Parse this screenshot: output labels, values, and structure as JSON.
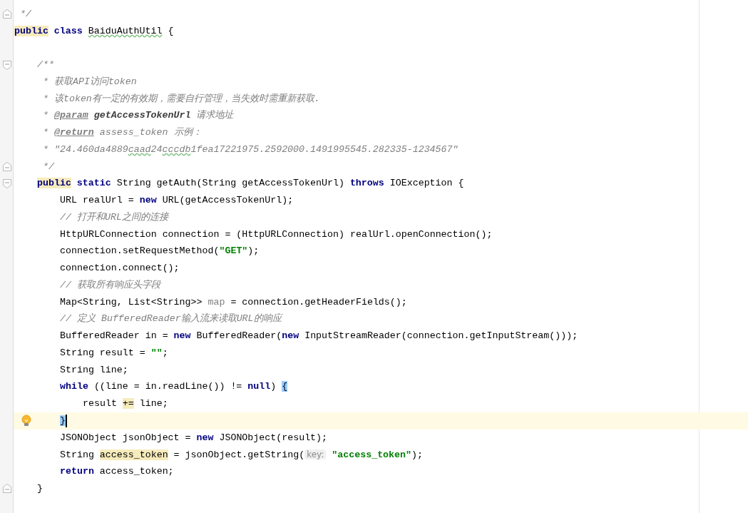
{
  "editor": {
    "lines": [
      {
        "fold_end": true,
        "tokens": [
          {
            "text": " */",
            "kind": "comment"
          }
        ]
      },
      {
        "tokens": [
          {
            "text": "public",
            "kind": "keyword",
            "usage_highlight": true
          },
          {
            "text": " class ",
            "kind": "keyword"
          },
          {
            "text": "BaiduAuthUtil",
            "typo": true
          },
          {
            "text": " {"
          }
        ],
        "children": [
          {
            "blank": true
          },
          {
            "fold_start": true,
            "tokens": [
              {
                "text": "/**",
                "kind": "comment"
              }
            ]
          },
          {
            "tokens": [
              {
                "text": " * 获取API访问token",
                "kind": "comment"
              }
            ]
          },
          {
            "tokens": [
              {
                "text": " * 该token有一定的有效期，需要自行管理，当失效时需重新获取.",
                "kind": "comment"
              }
            ]
          },
          {
            "tokens": [
              {
                "text": " * ",
                "kind": "comment"
              },
              {
                "text": "@param",
                "kind": "doc-tag"
              },
              {
                "text": " getAccessTokenUrl",
                "kind": "doc-param"
              },
              {
                "text": " 请求地址",
                "kind": "comment"
              }
            ]
          },
          {
            "tokens": [
              {
                "text": " * ",
                "kind": "comment"
              },
              {
                "text": "@return",
                "kind": "doc-tag"
              },
              {
                "text": " assess_token 示例：",
                "kind": "comment"
              }
            ]
          },
          {
            "tokens": [
              {
                "text": " * \"24.460da4889",
                "kind": "comment"
              },
              {
                "text": "caad",
                "kind": "comment",
                "typo": true
              },
              {
                "text": "24",
                "kind": "comment"
              },
              {
                "text": "cccdb",
                "kind": "comment",
                "typo": true
              },
              {
                "text": "1fea17221975.2592000.1491995545.282335-1234567\"",
                "kind": "comment"
              }
            ]
          },
          {
            "fold_end": true,
            "tokens": [
              {
                "text": " */",
                "kind": "comment"
              }
            ]
          },
          {
            "fold_start": true,
            "tokens": [
              {
                "text": "public",
                "kind": "keyword",
                "usage_highlight": true
              },
              {
                "text": " static",
                "kind": "keyword"
              },
              {
                "text": " String getAuth(String getAccessTokenUrl) "
              },
              {
                "text": "throws",
                "kind": "keyword"
              },
              {
                "text": " IOException {"
              }
            ],
            "children": [
              {
                "tokens": [
                  {
                    "text": "URL realUrl = "
                  },
                  {
                    "text": "new",
                    "kind": "keyword"
                  },
                  {
                    "text": " URL(getAccessTokenUrl);"
                  }
                ]
              },
              {
                "tokens": [
                  {
                    "text": "// 打开和URL之间的连接",
                    "kind": "comment"
                  }
                ]
              },
              {
                "tokens": [
                  {
                    "text": "HttpURLConnection connection = (HttpURLConnection) realUrl.openConnection();"
                  }
                ]
              },
              {
                "tokens": [
                  {
                    "text": "connection.setRequestMethod("
                  },
                  {
                    "text": "\"GET\"",
                    "kind": "string"
                  },
                  {
                    "text": ");"
                  }
                ]
              },
              {
                "tokens": [
                  {
                    "text": "connection.connect();"
                  }
                ]
              },
              {
                "tokens": [
                  {
                    "text": "// 获取所有响应头字段",
                    "kind": "comment"
                  }
                ]
              },
              {
                "tokens": [
                  {
                    "text": "Map<String, List<String>> "
                  },
                  {
                    "text": "map",
                    "kind": "unused"
                  },
                  {
                    "text": " = connection.getHeaderFields();"
                  }
                ]
              },
              {
                "tokens": [
                  {
                    "text": "// 定义 BufferedReader输入流来读取URL的响应",
                    "kind": "comment"
                  }
                ]
              },
              {
                "tokens": [
                  {
                    "text": "BufferedReader in = "
                  },
                  {
                    "text": "new",
                    "kind": "keyword"
                  },
                  {
                    "text": " BufferedReader("
                  },
                  {
                    "text": "new",
                    "kind": "keyword"
                  },
                  {
                    "text": " InputStreamReader(connection.getInputStream()));"
                  }
                ]
              },
              {
                "tokens": [
                  {
                    "text": "String result = "
                  },
                  {
                    "text": "\"\"",
                    "kind": "string"
                  },
                  {
                    "text": ";"
                  }
                ]
              },
              {
                "tokens": [
                  {
                    "text": "String line;"
                  }
                ]
              },
              {
                "tokens": [
                  {
                    "text": "while",
                    "kind": "keyword"
                  },
                  {
                    "text": " ((line = in.readLine()) != "
                  },
                  {
                    "text": "null",
                    "kind": "keyword"
                  },
                  {
                    "text": ") "
                  },
                  {
                    "text": "{",
                    "brace_match": true
                  }
                ],
                "children": [
                  {
                    "tokens": [
                      {
                        "text": "result "
                      },
                      {
                        "text": "+=",
                        "usage_highlight": true
                      },
                      {
                        "text": " line;"
                      }
                    ]
                  }
                ]
              },
              {
                "current": true,
                "lightbulb": true,
                "tokens": [
                  {
                    "text": "}",
                    "brace_match": true
                  }
                ]
              },
              {
                "tokens": [
                  {
                    "text": "JSONObject jsonObject = "
                  },
                  {
                    "text": "new",
                    "kind": "keyword"
                  },
                  {
                    "text": " JSONObject(result);"
                  }
                ]
              },
              {
                "tokens": [
                  {
                    "text": "String "
                  },
                  {
                    "text": "access_token",
                    "usage_highlight": true
                  },
                  {
                    "text": " = jsonObject.getString("
                  },
                  {
                    "text": "key:",
                    "kind": "hint"
                  },
                  {
                    "text": " \"access_token\"",
                    "kind": "string"
                  },
                  {
                    "text": ");"
                  }
                ]
              },
              {
                "tokens": [
                  {
                    "text": "return",
                    "kind": "keyword"
                  },
                  {
                    "text": " access_token;"
                  }
                ]
              }
            ]
          },
          {
            "fold_end": true,
            "tokens": [
              {
                "text": "}"
              }
            ]
          }
        ]
      }
    ]
  }
}
